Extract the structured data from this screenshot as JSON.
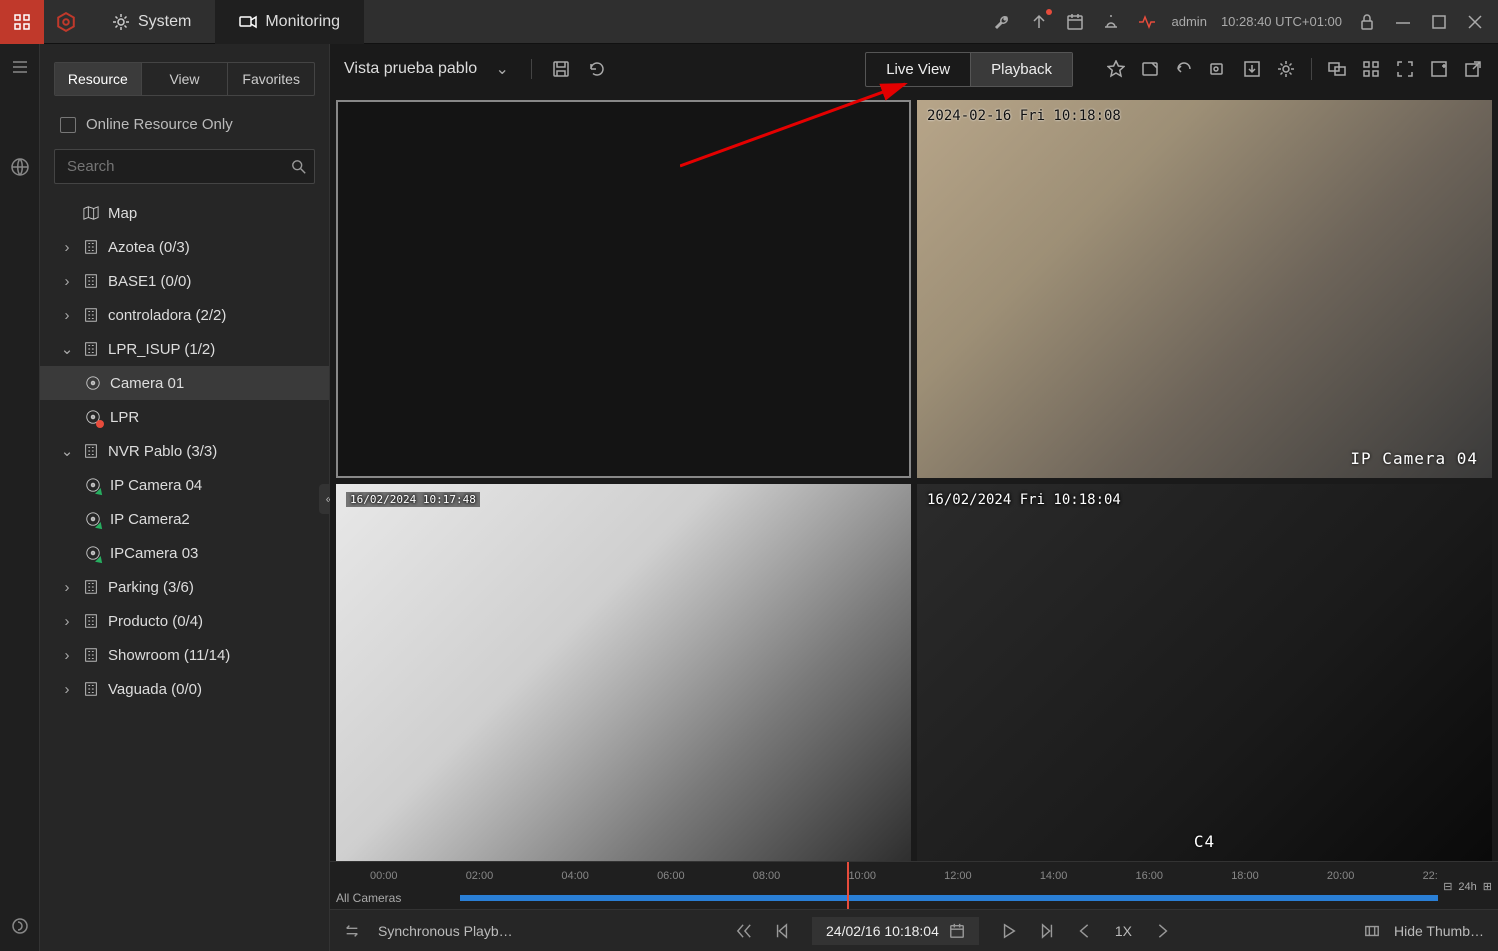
{
  "topbar": {
    "tabs": {
      "system": "System",
      "monitoring": "Monitoring"
    },
    "user": "admin",
    "clock": "10:28:40 UTC+01:00"
  },
  "sidebar": {
    "tabs": {
      "resource": "Resource",
      "view": "View",
      "favorites": "Favorites"
    },
    "online_only": "Online Resource Only",
    "search_placeholder": "Search",
    "tree": {
      "map": "Map",
      "azotea": "Azotea (0/3)",
      "base1": "BASE1 (0/0)",
      "controladora": "controladora (2/2)",
      "lpr_isup": "LPR_ISUP (1/2)",
      "camera01": "Camera 01",
      "lpr": "LPR",
      "nvr_pablo": "NVR Pablo (3/3)",
      "ipcam04": "IP Camera 04",
      "ipcam2": "IP Camera2",
      "ipcam03": "IPCamera 03",
      "parking": "Parking (3/6)",
      "producto": "Producto (0/4)",
      "showroom": "Showroom (11/14)",
      "vaguada": "Vaguada (0/0)"
    }
  },
  "toolbar": {
    "view_name": "Vista prueba pablo",
    "live_view": "Live View",
    "playback": "Playback"
  },
  "feeds": {
    "a_osd": "2024-02-16 Fri 10:18:08",
    "a_label": "IP Camera 04",
    "b_osd": "16/02/2024 10:17:48",
    "c_osd": "16/02/2024 Fri 10:18:04",
    "c_label": "C4"
  },
  "timeline": {
    "ticks": [
      "00:00",
      "02:00",
      "04:00",
      "06:00",
      "08:00",
      "10:00",
      "12:00",
      "14:00",
      "16:00",
      "18:00",
      "20:00",
      "22:"
    ],
    "all_cameras": "All Cameras",
    "zoom": "24h"
  },
  "playbar": {
    "sync": "Synchronous Playb…",
    "datetime": "24/02/16 10:18:04",
    "speed": "1X",
    "hide_thumb": "Hide Thumb…"
  }
}
